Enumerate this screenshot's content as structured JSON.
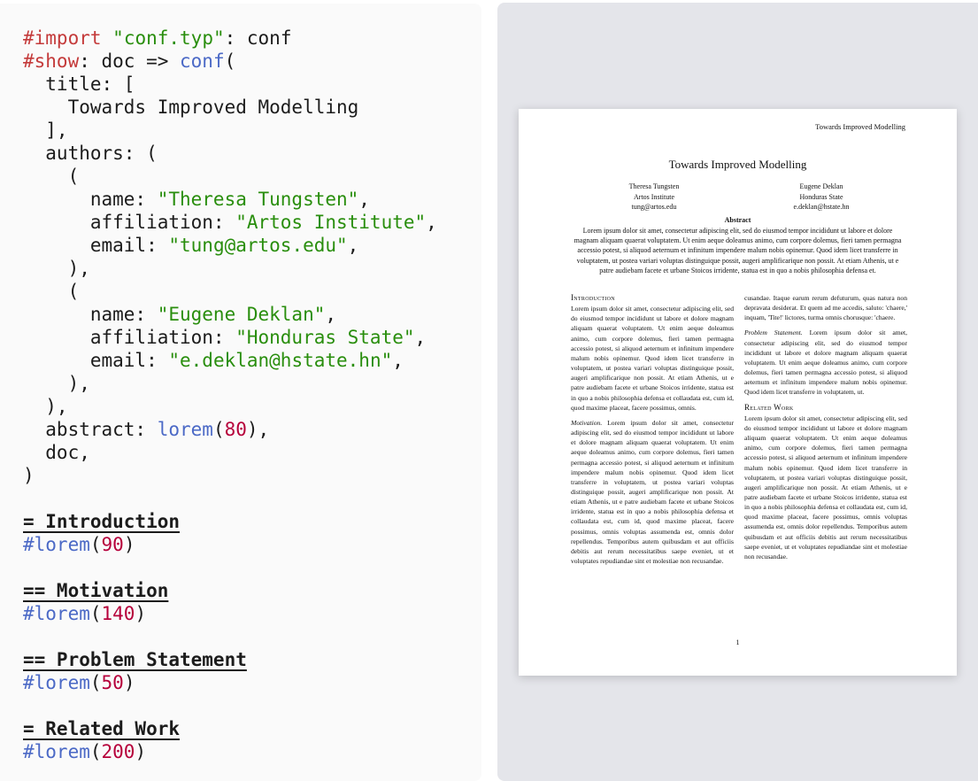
{
  "editor": {
    "lines": [
      {
        "tokens": [
          {
            "t": "#import",
            "c": "kw"
          },
          {
            "t": " ",
            "c": ""
          },
          {
            "t": "\"conf.typ\"",
            "c": "str"
          },
          {
            "t": ": conf",
            "c": ""
          }
        ]
      },
      {
        "tokens": [
          {
            "t": "#show",
            "c": "kw"
          },
          {
            "t": ": doc => ",
            "c": ""
          },
          {
            "t": "conf",
            "c": "fn"
          },
          {
            "t": "(",
            "c": ""
          }
        ]
      },
      {
        "tokens": [
          {
            "t": "  title: [",
            "c": ""
          }
        ]
      },
      {
        "tokens": [
          {
            "t": "    Towards Improved Modelling",
            "c": ""
          }
        ]
      },
      {
        "tokens": [
          {
            "t": "  ],",
            "c": ""
          }
        ]
      },
      {
        "tokens": [
          {
            "t": "  authors: (",
            "c": ""
          }
        ]
      },
      {
        "tokens": [
          {
            "t": "    (",
            "c": ""
          }
        ]
      },
      {
        "tokens": [
          {
            "t": "      name: ",
            "c": ""
          },
          {
            "t": "\"Theresa Tungsten\"",
            "c": "str"
          },
          {
            "t": ",",
            "c": ""
          }
        ]
      },
      {
        "tokens": [
          {
            "t": "      affiliation: ",
            "c": ""
          },
          {
            "t": "\"Artos Institute\"",
            "c": "str"
          },
          {
            "t": ",",
            "c": ""
          }
        ]
      },
      {
        "tokens": [
          {
            "t": "      email: ",
            "c": ""
          },
          {
            "t": "\"tung@artos.edu\"",
            "c": "str"
          },
          {
            "t": ",",
            "c": ""
          }
        ]
      },
      {
        "tokens": [
          {
            "t": "    ),",
            "c": ""
          }
        ]
      },
      {
        "tokens": [
          {
            "t": "    (",
            "c": ""
          }
        ]
      },
      {
        "tokens": [
          {
            "t": "      name: ",
            "c": ""
          },
          {
            "t": "\"Eugene Deklan\"",
            "c": "str"
          },
          {
            "t": ",",
            "c": ""
          }
        ]
      },
      {
        "tokens": [
          {
            "t": "      affiliation: ",
            "c": ""
          },
          {
            "t": "\"Honduras State\"",
            "c": "str"
          },
          {
            "t": ",",
            "c": ""
          }
        ]
      },
      {
        "tokens": [
          {
            "t": "      email: ",
            "c": ""
          },
          {
            "t": "\"e.deklan@hstate.hn\"",
            "c": "str"
          },
          {
            "t": ",",
            "c": ""
          }
        ]
      },
      {
        "tokens": [
          {
            "t": "    ),",
            "c": ""
          }
        ]
      },
      {
        "tokens": [
          {
            "t": "  ),",
            "c": ""
          }
        ]
      },
      {
        "tokens": [
          {
            "t": "  abstract: ",
            "c": ""
          },
          {
            "t": "lorem",
            "c": "fn"
          },
          {
            "t": "(",
            "c": ""
          },
          {
            "t": "80",
            "c": "num"
          },
          {
            "t": "),",
            "c": ""
          }
        ]
      },
      {
        "tokens": [
          {
            "t": "  doc,",
            "c": ""
          }
        ]
      },
      {
        "tokens": [
          {
            "t": ")",
            "c": ""
          }
        ]
      },
      {
        "tokens": []
      },
      {
        "tokens": [
          {
            "t": "= Introduction",
            "c": "hd"
          }
        ]
      },
      {
        "tokens": [
          {
            "t": "#lorem",
            "c": "fn"
          },
          {
            "t": "(",
            "c": ""
          },
          {
            "t": "90",
            "c": "num"
          },
          {
            "t": ")",
            "c": ""
          }
        ]
      },
      {
        "tokens": []
      },
      {
        "tokens": [
          {
            "t": "== Motivation",
            "c": "hd"
          }
        ]
      },
      {
        "tokens": [
          {
            "t": "#lorem",
            "c": "fn"
          },
          {
            "t": "(",
            "c": ""
          },
          {
            "t": "140",
            "c": "num"
          },
          {
            "t": ")",
            "c": ""
          }
        ]
      },
      {
        "tokens": []
      },
      {
        "tokens": [
          {
            "t": "== Problem Statement",
            "c": "hd"
          }
        ]
      },
      {
        "tokens": [
          {
            "t": "#lorem",
            "c": "fn"
          },
          {
            "t": "(",
            "c": ""
          },
          {
            "t": "50",
            "c": "num"
          },
          {
            "t": ")",
            "c": ""
          }
        ]
      },
      {
        "tokens": []
      },
      {
        "tokens": [
          {
            "t": "= Related Work",
            "c": "hd"
          }
        ]
      },
      {
        "tokens": [
          {
            "t": "#lorem",
            "c": "fn"
          },
          {
            "t": "(",
            "c": ""
          },
          {
            "t": "200",
            "c": "num"
          },
          {
            "t": ")",
            "c": ""
          }
        ]
      }
    ]
  },
  "preview": {
    "header": "Towards Improved Modelling",
    "title": "Towards Improved Modelling",
    "authors": [
      {
        "name": "Theresa Tungsten",
        "affiliation": "Artos Institute",
        "email": "tung@artos.edu"
      },
      {
        "name": "Eugene Deklan",
        "affiliation": "Honduras State",
        "email": "e.deklan@hstate.hn"
      }
    ],
    "abstract_heading": "Abstract",
    "abstract": "Lorem ipsum dolor sit amet, consectetur adipiscing elit, sed do eiusmod tempor incididunt ut labore et dolore magnam aliquam quaerat voluptatem. Ut enim aeque doleamus animo, cum corpore dolemus, fieri tamen permagna accessio potest, si aliquod aeternum et infinitum impendere malum nobis opinemur. Quod idem licet transferre in voluptatem, ut postea variari voluptas distinguique possit, augeri amplificarique non possit. At etiam Athenis, ut e patre audiebam facete et urbane Stoicos irridente, statua est in quo a nobis philosophia defensa et.",
    "col1": {
      "intro_heading": "Introduction",
      "intro_text": "Lorem ipsum dolor sit amet, consectetur adipiscing elit, sed do eiusmod tempor incididunt ut labore et dolore magnam aliquam quaerat voluptatem. Ut enim aeque doleamus animo, cum corpore dolemus, fieri tamen permagna accessio potest, si aliquod aeternum et infinitum impendere malum nobis opinemur. Quod idem licet transferre in voluptatem, ut postea variari voluptas distinguique possit, augeri amplificarique non possit. At etiam Athenis, ut e patre audiebam facete et urbane Stoicos irridente, statua est in quo a nobis philosophia defensa et collaudata est, cum id, quod maxime placeat, facere possimus, omnis.",
      "motivation_label": "Motivation.",
      "motivation_text": " Lorem ipsum dolor sit amet, consectetur adipiscing elit, sed do eiusmod tempor incididunt ut labore et dolore magnam aliquam quaerat voluptatem. Ut enim aeque doleamus animo, cum corpore dolemus, fieri tamen permagna accessio potest, si aliquod aeternum et infinitum impendere malum nobis opinemur. Quod idem licet transferre in voluptatem, ut postea variari voluptas distinguique possit, augeri amplificarique non possit. At etiam Athenis, ut e patre audiebam facete et urbane Stoicos irridente, statua est in quo a nobis philosophia defensa et collaudata est, cum id, quod maxime placeat, facere possimus, omnis voluptas assumenda est, omnis dolor repellendus. Temporibus autem quibusdam et aut officiis debitis aut rerum necessitatibus saepe eveniet, ut et voluptates repudiandae sint et molestiae non recusandae."
    },
    "col2": {
      "carry_text": "cusandae. Itaque earum rerum defuturum, quas natura non depravata desiderat. Et quem ad me accedis, saluto: 'chaere,' inquam, 'Tite!' lictores, turma omnis chorusque: 'chaere.",
      "problem_label": "Problem Statement.",
      "problem_text": " Lorem ipsum dolor sit amet, consectetur adipiscing elit, sed do eiusmod tempor incididunt ut labore et dolore magnam aliquam quaerat voluptatem. Ut enim aeque doleamus animo, cum corpore dolemus, fieri tamen permagna accessio potest, si aliquod aeternum et infinitum impendere malum nobis opinemur. Quod idem licet transferre in voluptatem, ut.",
      "related_heading": "Related Work",
      "related_text": "Lorem ipsum dolor sit amet, consectetur adipiscing elit, sed do eiusmod tempor incididunt ut labore et dolore magnam aliquam quaerat voluptatem. Ut enim aeque doleamus animo, cum corpore dolemus, fieri tamen permagna accessio potest, si aliquod aeternum et infinitum impendere malum nobis opinemur. Quod idem licet transferre in voluptatem, ut postea variari voluptas distinguique possit, augeri amplificarique non possit. At etiam Athenis, ut e patre audiebam facete et urbane Stoicos irridente, statua est in quo a nobis philosophia defensa et collaudata est, cum id, quod maxime placeat, facere possimus, omnis voluptas assumenda est, omnis dolor repellendus. Temporibus autem quibusdam et aut officiis debitis aut rerum necessitatibus saepe eveniet, ut et voluptates repudiandae sint et molestiae non recusandae."
    },
    "page_number": "1"
  }
}
